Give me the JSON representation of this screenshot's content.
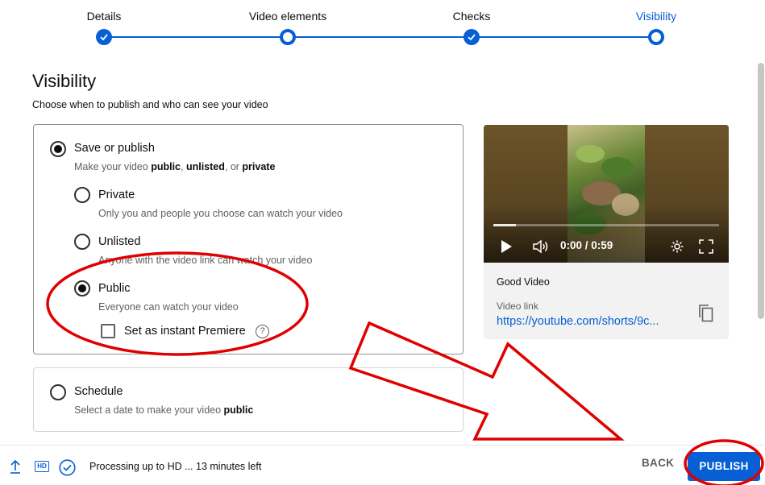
{
  "stepper": {
    "steps": [
      {
        "label": "Details",
        "state": "done"
      },
      {
        "label": "Video elements",
        "state": "done"
      },
      {
        "label": "Checks",
        "state": "done"
      },
      {
        "label": "Visibility",
        "state": "current"
      }
    ]
  },
  "page": {
    "title": "Visibility",
    "subtitle": "Choose when to publish and who can see your video"
  },
  "save_or_publish": {
    "label": "Save or publish",
    "desc_prefix": "Make your video ",
    "desc_public": "public",
    "desc_sep1": ", ",
    "desc_unlisted": "unlisted",
    "desc_sep2": ", or ",
    "desc_private": "private",
    "selected": true,
    "options": [
      {
        "label": "Private",
        "desc": "Only you and people you choose can watch your video",
        "selected": false
      },
      {
        "label": "Unlisted",
        "desc": "Anyone with the video link can watch your video",
        "selected": false
      },
      {
        "label": "Public",
        "desc": "Everyone can watch your video",
        "selected": true
      }
    ],
    "premiere": {
      "label": "Set as instant Premiere",
      "checked": false,
      "help": "?"
    }
  },
  "schedule": {
    "label": "Schedule",
    "desc_prefix": "Select a date to make your video ",
    "desc_bold": "public",
    "selected": false
  },
  "preview": {
    "time": "0:00 / 0:59",
    "progress_fraction": 0.1,
    "name": "Good Video",
    "link_label": "Video link",
    "link": "https://youtube.com/shorts/9c..."
  },
  "footer": {
    "processing": "Processing up to HD ... 13 minutes left",
    "hd": "HD",
    "back": "BACK",
    "publish": "PUBLISH"
  },
  "colors": {
    "accent": "#065fd4",
    "annotation": "#e00000"
  }
}
